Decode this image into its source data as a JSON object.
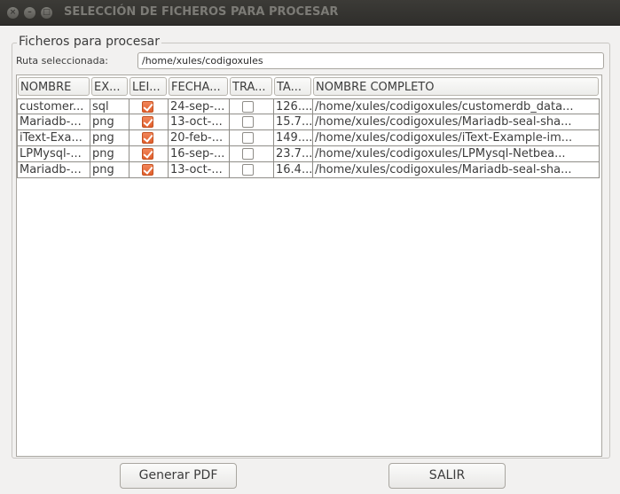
{
  "window": {
    "title": "SELECCIÓN DE FICHEROS PARA PROCESAR",
    "controls": {
      "close": "×",
      "minimize": "–",
      "maximize": "□"
    }
  },
  "group": {
    "title": "Ficheros para procesar",
    "ruta_label": "Ruta seleccionada:",
    "ruta_value": "/home/xules/codigoxules"
  },
  "table": {
    "headers": [
      "NOMBRE",
      "EX...",
      "LEI...",
      "FECHA...",
      "TRA...",
      "TA...",
      "NOMBRE COMPLETO"
    ],
    "rows": [
      {
        "nombre": "customer...",
        "ext": "sql",
        "leido": true,
        "fecha": "24-sep-...",
        "tratado": false,
        "tamano": "126....",
        "completo": "/home/xules/codigoxules/customerdb_data..."
      },
      {
        "nombre": "Mariadb-...",
        "ext": "png",
        "leido": true,
        "fecha": "13-oct-...",
        "tratado": false,
        "tamano": "15.7...",
        "completo": "/home/xules/codigoxules/Mariadb-seal-sha..."
      },
      {
        "nombre": "iText-Exa...",
        "ext": "png",
        "leido": true,
        "fecha": "20-feb-...",
        "tratado": false,
        "tamano": "149....",
        "completo": "/home/xules/codigoxules/iText-Example-im..."
      },
      {
        "nombre": "LPMysql-...",
        "ext": "png",
        "leido": true,
        "fecha": "16-sep-...",
        "tratado": false,
        "tamano": "23.7...",
        "completo": "/home/xules/codigoxules/LPMysql-Netbea..."
      },
      {
        "nombre": "Mariadb-...",
        "ext": "png",
        "leido": true,
        "fecha": "13-oct-...",
        "tratado": false,
        "tamano": "16.4...",
        "completo": "/home/xules/codigoxules/Mariadb-seal-sha..."
      }
    ]
  },
  "buttons": {
    "generar": "Generar PDF",
    "salir": "SALIR"
  },
  "colors": {
    "titlebar": "#3c3b37",
    "checkbox_accent": "#e9703f",
    "background": "#f2f1f0"
  }
}
